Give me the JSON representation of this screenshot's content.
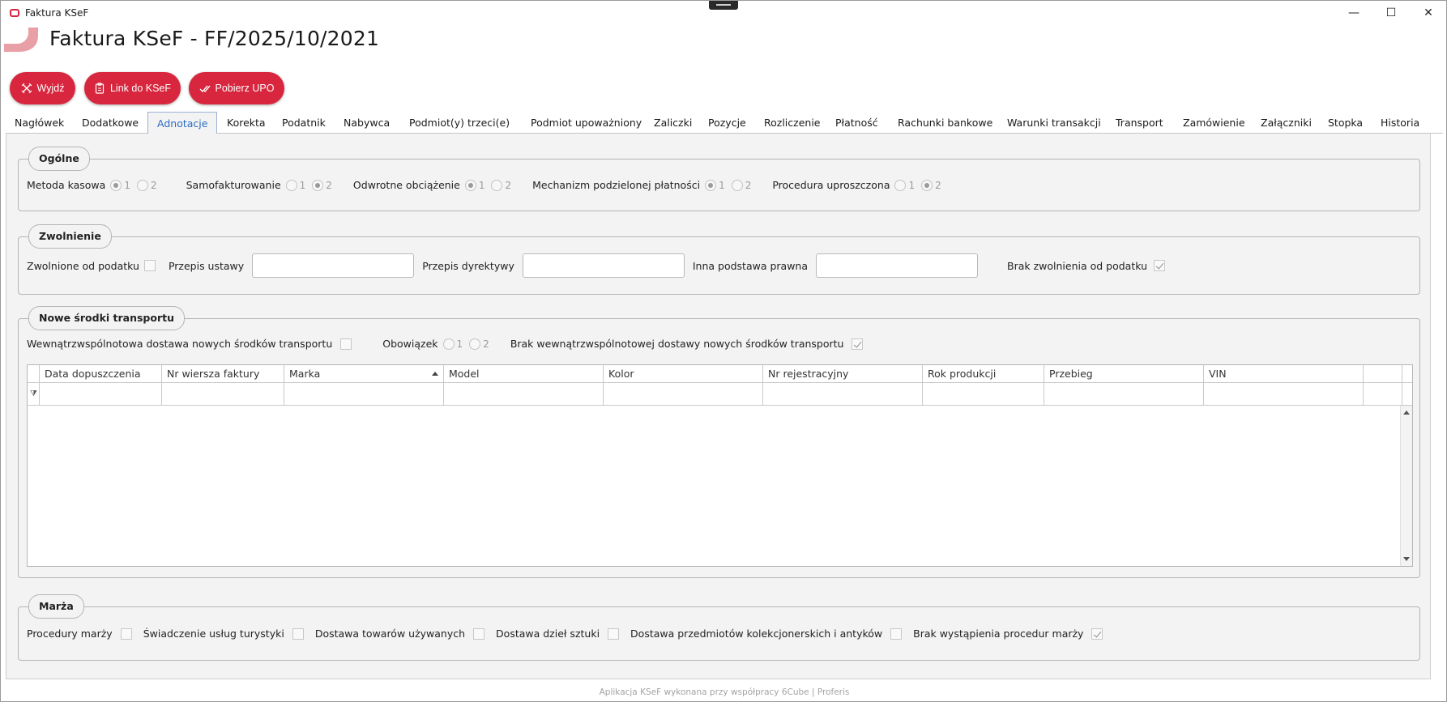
{
  "window": {
    "titlebar_text": "Faktura KSeF",
    "minimize": "—",
    "maximize": "☐",
    "close": "✕"
  },
  "header": {
    "title": "Faktura KSeF -  FF/2025/10/2021"
  },
  "actions": {
    "exit": "Wyjdź",
    "link": "Link do KSeF",
    "upo": "Pobierz UPO"
  },
  "tabs": [
    "Nagłówek",
    "Dodatkowe",
    "Adnotacje",
    "Korekta",
    "Podatnik",
    "Nabywca",
    "Podmiot(y) trzeci(e)",
    "Podmiot upoważniony",
    "Zaliczki",
    "Pozycje",
    "Rozliczenie",
    "Płatność",
    "Rachunki bankowe",
    "Warunki transakcji",
    "Transport",
    "Zamówienie",
    "Załączniki",
    "Stopka",
    "Historia"
  ],
  "active_tab": "Adnotacje",
  "ogolne": {
    "legend": "Ogólne",
    "opt1": "1",
    "opt2": "2",
    "metoda_kasowa": "Metoda kasowa",
    "samofakturowanie": "Samofakturowanie",
    "odwrotne": "Odwrotne obciążenie",
    "mechanizm": "Mechanizm podzielonej płatności",
    "procedura": "Procedura uproszczona"
  },
  "zwolnienie": {
    "legend": "Zwolnienie",
    "zwolnione": "Zwolnione od podatku",
    "przepis_ustawy": "Przepis ustawy",
    "przepis_dyrektywy": "Przepis dyrektywy",
    "inna_podstawa": "Inna podstawa prawna",
    "brak_zwolnienia": "Brak zwolnienia od podatku"
  },
  "transport": {
    "legend": "Nowe środki transportu",
    "wdt": "Wewnątrzwspólnotowa dostawa nowych środków transportu",
    "obowiazek": "Obowiązek",
    "brak_wdt": "Brak wewnątrzwspólnotowej dostawy nowych środków transportu",
    "columns": [
      "Data dopuszczenia",
      "Nr wiersza faktury",
      "Marka",
      "Model",
      "Kolor",
      "Nr rejestracyjny",
      "Rok produkcji",
      "Przebieg",
      "VIN"
    ]
  },
  "marza": {
    "legend": "Marża",
    "procedury": "Procedury marży",
    "turystyka": "Świadczenie usług turystyki",
    "towary": "Dostawa towarów używanych",
    "dziela": "Dostawa dzieł sztuki",
    "kolekcje": "Dostawa przedmiotów kolekcjonerskich i antyków",
    "brak": "Brak wystąpienia procedur marży"
  },
  "footer": "Aplikacja KSeF wykonana przy współpracy 6Cube | Proferis",
  "colors": {
    "accent": "#d7263d",
    "active_tab": "#2b6cc4"
  }
}
